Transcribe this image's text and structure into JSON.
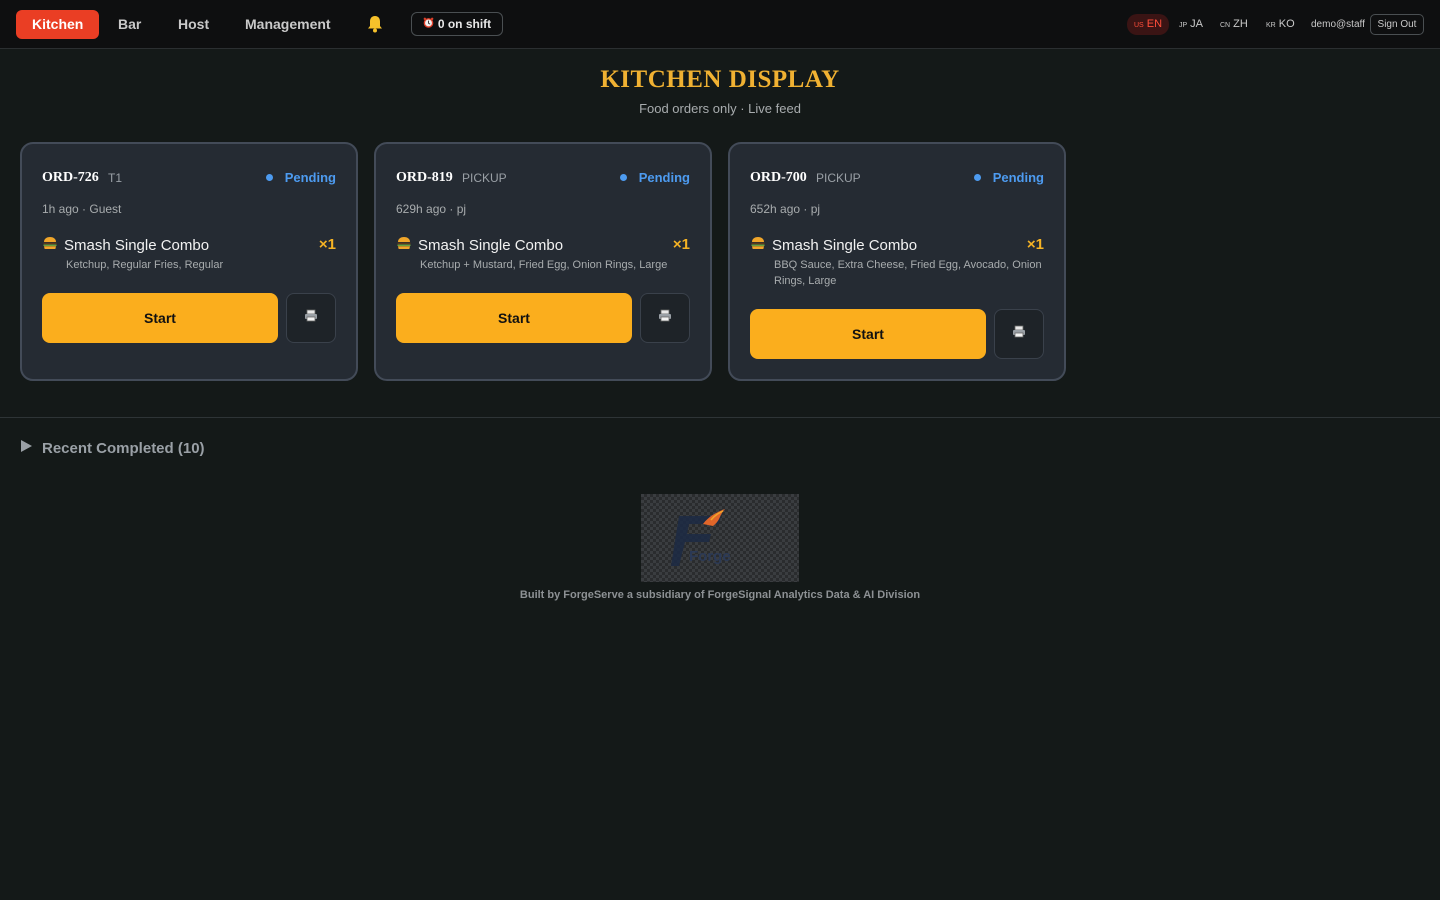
{
  "nav": {
    "tabs": [
      {
        "label": "Kitchen",
        "active": true
      },
      {
        "label": "Bar",
        "active": false
      },
      {
        "label": "Host",
        "active": false
      },
      {
        "label": "Management",
        "active": false
      }
    ],
    "shift_label": "0 on shift",
    "languages": [
      {
        "code": "US",
        "label": "EN",
        "active": true
      },
      {
        "code": "JP",
        "label": "JA",
        "active": false
      },
      {
        "code": "CN",
        "label": "ZH",
        "active": false
      },
      {
        "code": "KR",
        "label": "KO",
        "active": false
      }
    ],
    "user": "demo@staff",
    "sign_out_label": "Sign Out"
  },
  "header": {
    "title": "KITCHEN DISPLAY",
    "subtitle": "Food orders only · Live feed"
  },
  "orders": [
    {
      "id": "ORD-726",
      "tag": "T1",
      "status": "Pending",
      "meta": "1h ago · Guest",
      "item": "Smash Single Combo",
      "qty": "×1",
      "mods": "Ketchup, Regular Fries, Regular",
      "start_label": "Start"
    },
    {
      "id": "ORD-819",
      "tag": "PICKUP",
      "status": "Pending",
      "meta": "629h ago · pj",
      "item": "Smash Single Combo",
      "qty": "×1",
      "mods": "Ketchup + Mustard, Fried Egg, Onion Rings, Large",
      "start_label": "Start"
    },
    {
      "id": "ORD-700",
      "tag": "PICKUP",
      "status": "Pending",
      "meta": "652h ago · pj",
      "item": "Smash Single Combo",
      "qty": "×1",
      "mods": "BBQ Sauce, Extra Cheese, Fried Egg, Avocado, Onion Rings, Large",
      "start_label": "Start"
    }
  ],
  "recent": {
    "label": "Recent Completed (10)"
  },
  "logo": {
    "text": "Forge"
  },
  "footer": {
    "text": "Built by ForgeServe a subsidiary of ForgeSignal Analytics Data & AI Division"
  },
  "colors": {
    "accent_red": "#ea3e24",
    "title_gold": "#f0b132",
    "status_blue": "#4d9bf0",
    "start_yellow": "#fbae1d"
  }
}
